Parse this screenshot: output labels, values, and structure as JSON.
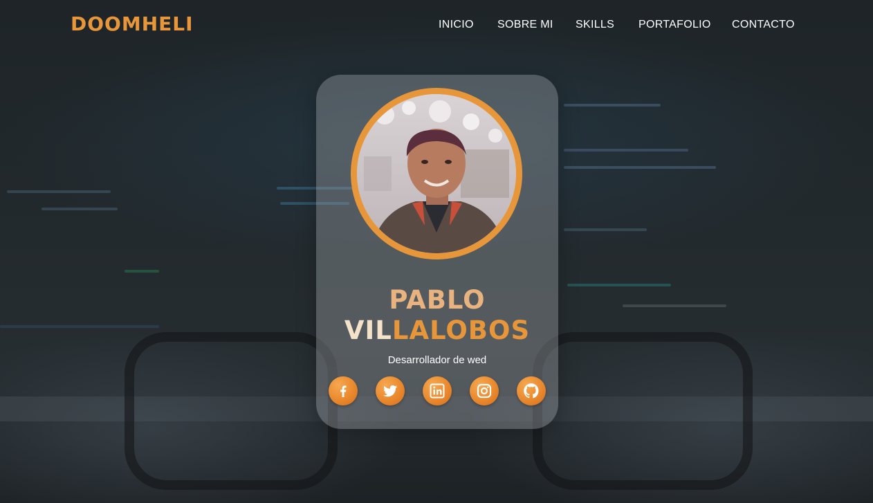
{
  "header": {
    "brand": "DOOMHELI",
    "nav": [
      {
        "label": "INICIO"
      },
      {
        "label": "SOBRE MI"
      },
      {
        "label": "SKILLS"
      },
      {
        "label": "PORTAFOLIO"
      },
      {
        "label": "CONTACTO"
      }
    ]
  },
  "profile": {
    "name_first": "PABLO",
    "name_last_part1": "VIL",
    "name_last_part2": "LALOBOS",
    "role": "Desarrollador de wed",
    "socials": [
      {
        "icon": "facebook-icon"
      },
      {
        "icon": "twitter-icon"
      },
      {
        "icon": "linkedin-icon"
      },
      {
        "icon": "instagram-icon"
      },
      {
        "icon": "github-icon"
      }
    ]
  },
  "colors": {
    "accent": "#e8963a",
    "name_light": "#f4e2c9",
    "name_first": "#e8b37f",
    "background": "#22292d"
  }
}
